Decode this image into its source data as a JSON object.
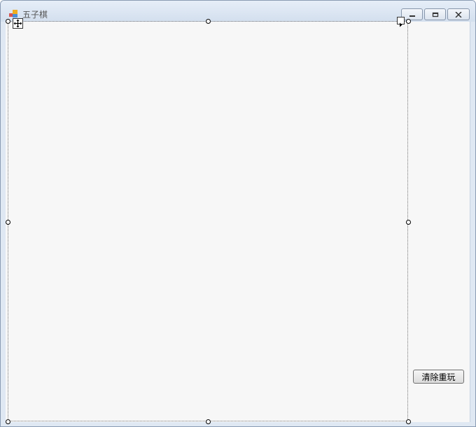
{
  "window": {
    "title": "五子棋"
  },
  "caption_buttons": {
    "minimize": "minimize-icon",
    "restore": "restore-icon",
    "close": "close-icon"
  },
  "main": {
    "reset_button_label": "清除重玩"
  }
}
